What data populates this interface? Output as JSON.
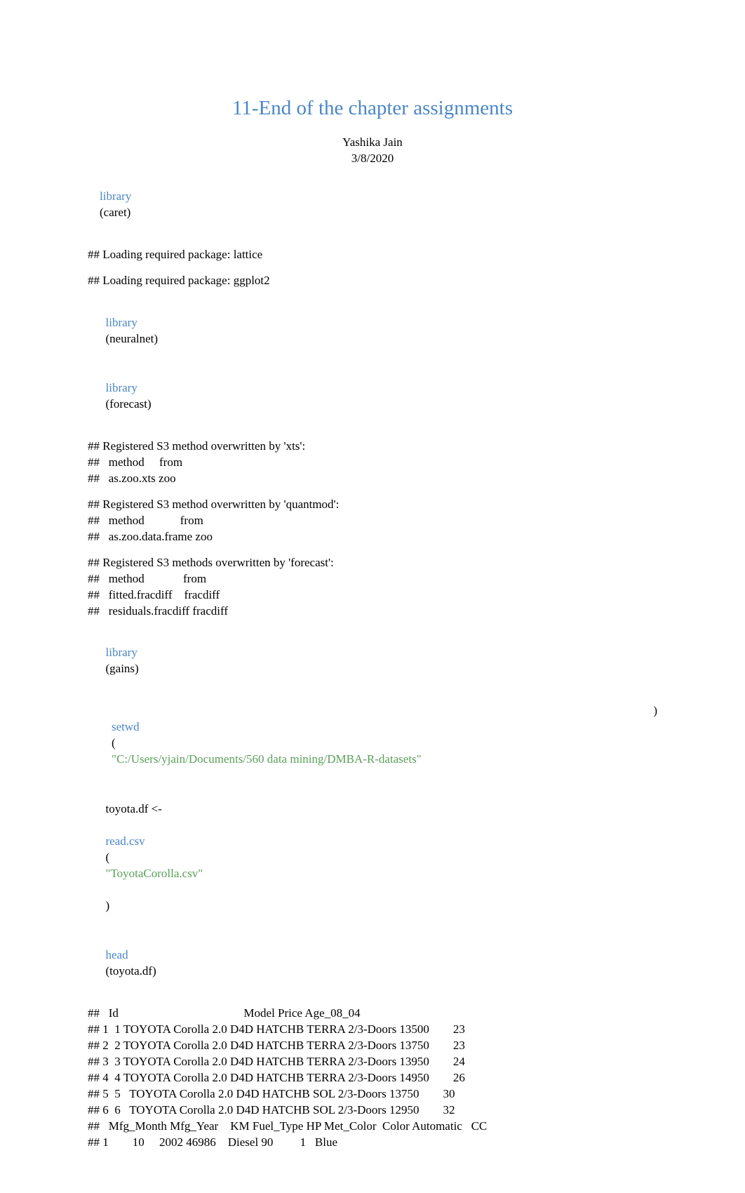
{
  "header": {
    "title": "11-End of the chapter assignments",
    "author": "Yashika Jain",
    "date": "3/8/2020"
  },
  "code": {
    "library_fn": "library",
    "pkg_caret": "(caret)",
    "pkg_neuralnet": "(neuralnet)",
    "pkg_forecast": "(forecast)",
    "pkg_gains": "(gains)",
    "setwd_fn": "setwd",
    "setwd_open": "(",
    "setwd_path": "\"C:/Users/yjain/Documents/560 data mining/DMBA-R-datasets\"",
    "setwd_close": ")",
    "toyota_assign": "toyota.df <-",
    "readcsv_fn": "read.csv",
    "readcsv_open": "(",
    "readcsv_file": "\"ToyotaCorolla.csv\"",
    "readcsv_close": ")",
    "head_fn": "head",
    "head_arg": "(toyota.df)"
  },
  "out": {
    "o1": "## Loading required package: lattice",
    "o2": "## Loading required package: ggplot2",
    "o3": "## Registered S3 method overwritten by 'xts':",
    "o4": "##   method     from",
    "o5": "##   as.zoo.xts zoo",
    "o6": "## Registered S3 method overwritten by 'quantmod':",
    "o7": "##   method            from",
    "o8": "##   as.zoo.data.frame zoo",
    "o9": "## Registered S3 methods overwritten by 'forecast':",
    "o10": "##   method             from    ",
    "o11": "##   fitted.fracdiff    fracdiff",
    "o12": "##   residuals.fracdiff fracdiff",
    "h1": "##   Id                                          Model Price Age_08_04",
    "h2": "## 1  1 TOYOTA Corolla 2.0 D4D HATCHB TERRA 2/3-Doors 13500        23",
    "h3": "## 2  2 TOYOTA Corolla 2.0 D4D HATCHB TERRA 2/3-Doors 13750        23",
    "h4": "## 3  3 TOYOTA Corolla 2.0 D4D HATCHB TERRA 2/3-Doors 13950        24",
    "h5": "## 4  4 TOYOTA Corolla 2.0 D4D HATCHB TERRA 2/3-Doors 14950        26",
    "h6": "## 5  5   TOYOTA Corolla 2.0 D4D HATCHB SOL 2/3-Doors 13750        30",
    "h7": "## 6  6   TOYOTA Corolla 2.0 D4D HATCHB SOL 2/3-Doors 12950        32",
    "h8": "##   Mfg_Month Mfg_Year    KM Fuel_Type HP Met_Color  Color Automatic   CC",
    "h9": "## 1        10     2002 46986    Diesel 90         1   Blue"
  },
  "chart_data": {
    "type": "table",
    "title": "head(toyota.df)",
    "columns": [
      "Id",
      "Model",
      "Price",
      "Age_08_04",
      "Mfg_Month",
      "Mfg_Year",
      "KM",
      "Fuel_Type",
      "HP",
      "Met_Color",
      "Color",
      "Automatic",
      "CC"
    ],
    "rows": [
      {
        "Id": 1,
        "Model": "TOYOTA Corolla 2.0 D4D HATCHB TERRA 2/3-Doors",
        "Price": 13500,
        "Age_08_04": 23,
        "Mfg_Month": 10,
        "Mfg_Year": 2002,
        "KM": 46986,
        "Fuel_Type": "Diesel",
        "HP": 90,
        "Met_Color": 1,
        "Color": "Blue"
      },
      {
        "Id": 2,
        "Model": "TOYOTA Corolla 2.0 D4D HATCHB TERRA 2/3-Doors",
        "Price": 13750,
        "Age_08_04": 23
      },
      {
        "Id": 3,
        "Model": "TOYOTA Corolla 2.0 D4D HATCHB TERRA 2/3-Doors",
        "Price": 13950,
        "Age_08_04": 24
      },
      {
        "Id": 4,
        "Model": "TOYOTA Corolla 2.0 D4D HATCHB TERRA 2/3-Doors",
        "Price": 14950,
        "Age_08_04": 26
      },
      {
        "Id": 5,
        "Model": "TOYOTA Corolla 2.0 D4D HATCHB SOL 2/3-Doors",
        "Price": 13750,
        "Age_08_04": 30
      },
      {
        "Id": 6,
        "Model": "TOYOTA Corolla 2.0 D4D HATCHB SOL 2/3-Doors",
        "Price": 12950,
        "Age_08_04": 32
      }
    ]
  }
}
